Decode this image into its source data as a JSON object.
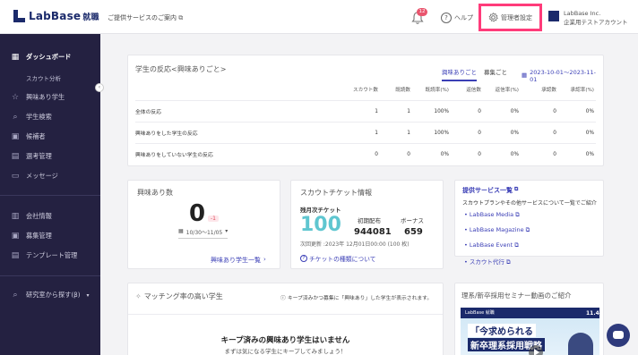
{
  "header": {
    "logo_text": "LabBase",
    "logo_sub": "就職",
    "service_link": "ご提供サービスのご案内",
    "notif_count": "12",
    "help_label": "ヘルプ",
    "admin_label": "管理者設定",
    "company_name": "LabBase Inc.",
    "company_account": "企業用テストアカウント"
  },
  "sidebar": {
    "items": [
      {
        "label": "ダッシュボード",
        "icon": "grid-icon"
      },
      {
        "label": "スカウト分析"
      },
      {
        "label": "興味あり学生",
        "icon": "star-icon"
      },
      {
        "label": "学生検索",
        "icon": "search-icon"
      },
      {
        "label": "候補者",
        "icon": "person-icon"
      },
      {
        "label": "選考管理",
        "icon": "doc-icon"
      },
      {
        "label": "メッセージ",
        "icon": "chat-icon"
      },
      {
        "label": "会社情報",
        "icon": "building-icon"
      },
      {
        "label": "募集管理",
        "icon": "person-icon"
      },
      {
        "label": "テンプレート管理",
        "icon": "doc-icon"
      },
      {
        "label": "研究室から探す(β)",
        "icon": "search-icon"
      }
    ]
  },
  "interest": {
    "title": "学生の反応<興味ありごと>",
    "tab1": "興味ありごと",
    "tab2": "募集ごと",
    "date": "2023-10-01〜2023-11-01",
    "columns": [
      "スカウト数",
      "既読数",
      "既読率(%)",
      "返信数",
      "返信率(%)",
      "承認数",
      "承認率(%)"
    ],
    "rows": [
      {
        "label": "全体の反応",
        "values": [
          "1",
          "1",
          "100%",
          "0",
          "0%",
          "0",
          "0%"
        ]
      },
      {
        "label": "興味ありをした学生の反応",
        "values": [
          "1",
          "1",
          "100%",
          "0",
          "0%",
          "0",
          "0%"
        ]
      },
      {
        "label": "興味ありをしていない学生の反応",
        "values": [
          "0",
          "0",
          "0%",
          "0",
          "0%",
          "0",
          "0%"
        ]
      }
    ]
  },
  "interest_count": {
    "title": "興味あり数",
    "value": "0",
    "delta": "-1",
    "range": "10/30〜11/05",
    "link": "興味あり学生一覧"
  },
  "ticket": {
    "title": "スカウトチケット情報",
    "monthly_label": "残月次チケット",
    "monthly_value": "100",
    "initial_label": "初期配布",
    "initial_value": "944081",
    "bonus_label": "ボーナス",
    "bonus_value": "659",
    "next_update": "次回更新 :2023年 12月01日00:00 (100 枚)",
    "link": "チケットの種類について"
  },
  "services": {
    "title": "提供サービス一覧",
    "desc": "スカウトプランやその他サービスについて一覧でご紹介",
    "items": [
      "LabBase Media",
      "LabBase Magazine",
      "LabBase Event",
      "スカウト代行"
    ]
  },
  "matching": {
    "title": "マッチング率の高い学生",
    "note": "キープ済みかつ募集に「興味あり」した学生が表示されます。",
    "empty_title": "キープ済みの興味あり学生はいません",
    "empty_sub": "まずは気になる学生にキープしてみましょう！"
  },
  "seminar": {
    "title": "理系/新卒採用セミナー動画のご紹介",
    "banner_brand": "LabBase 就職",
    "banner_line1": "「今求められる",
    "banner_line2": "新卒理系採用戦略",
    "banner_date": "11.4"
  }
}
